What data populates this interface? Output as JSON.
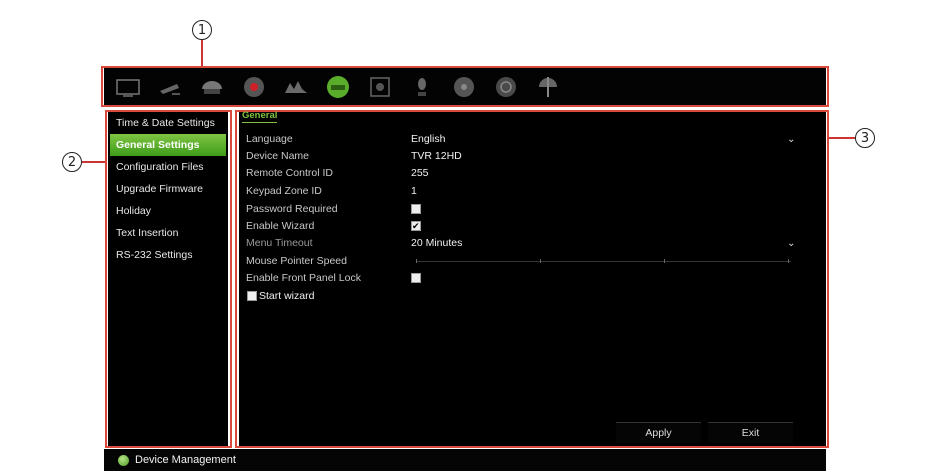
{
  "callouts": [
    "1",
    "2",
    "3"
  ],
  "toolbar": {
    "icons": [
      "monitor-icon",
      "camera-icon",
      "record-icon",
      "alarm-icon",
      "network-icon",
      "device-icon",
      "storage-icon",
      "user-icon",
      "settings-icon",
      "search-icon",
      "power-icon"
    ],
    "active_index": 5
  },
  "sidebar": {
    "items": [
      {
        "label": "Time & Date Settings"
      },
      {
        "label": "General Settings"
      },
      {
        "label": "Configuration Files"
      },
      {
        "label": "Upgrade Firmware"
      },
      {
        "label": "Holiday"
      },
      {
        "label": "Text Insertion"
      },
      {
        "label": "RS-232 Settings"
      }
    ],
    "active_index": 1
  },
  "main": {
    "tab": "General",
    "language": {
      "label": "Language",
      "value": "English"
    },
    "device_name": {
      "label": "Device Name",
      "value": "TVR 12HD"
    },
    "remote_id": {
      "label": "Remote Control ID",
      "value": "255"
    },
    "keypad_zone": {
      "label": "Keypad Zone ID",
      "value": "1"
    },
    "password_required": {
      "label": "Password Required",
      "checked": false
    },
    "enable_wizard": {
      "label": "Enable Wizard",
      "checked": true
    },
    "menu_timeout": {
      "label": "Menu Timeout",
      "value": "20 Minutes"
    },
    "mouse_speed": {
      "label": "Mouse Pointer Speed"
    },
    "front_panel_lock": {
      "label": "Enable Front Panel Lock",
      "checked": false
    },
    "start_wizard": {
      "label": "Start wizard",
      "checked": false
    },
    "apply_label": "Apply",
    "exit_label": "Exit"
  },
  "statusbar": {
    "text": "Device Management"
  },
  "colors": {
    "accent": "#5aad2a",
    "frame": "#d94a3c",
    "background": "#000000"
  }
}
